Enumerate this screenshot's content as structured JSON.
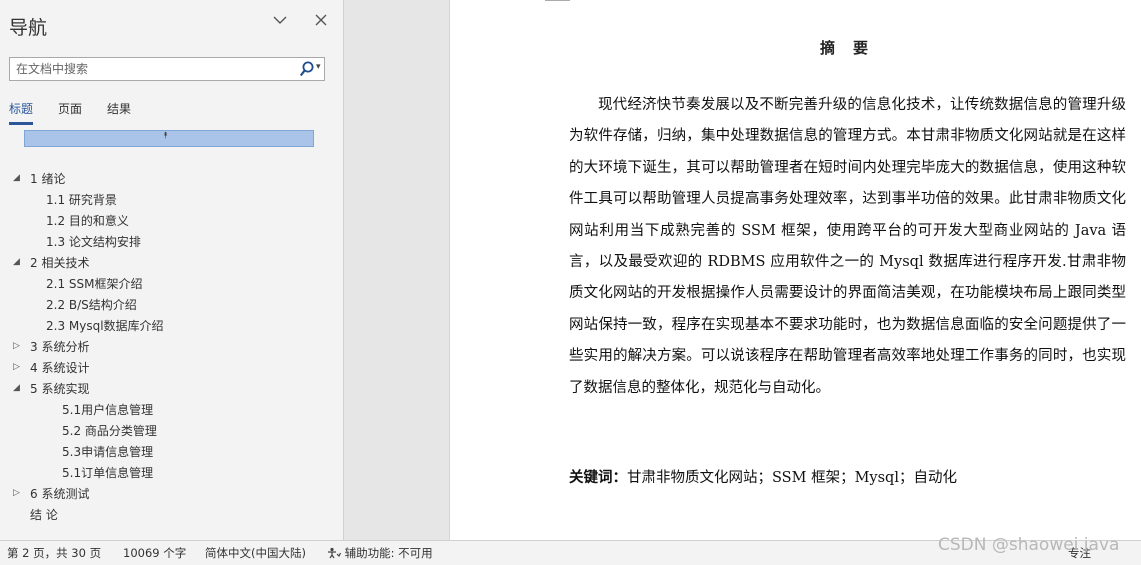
{
  "nav": {
    "title": "导航",
    "collapse_icon": "chevron-down-icon",
    "close_icon": "close-icon",
    "search": {
      "placeholder": "在文档中搜索",
      "value": ""
    },
    "tabs": [
      {
        "label": "标题",
        "active": true
      },
      {
        "label": "页面",
        "active": false
      },
      {
        "label": "结果",
        "active": false
      }
    ],
    "toc": [
      {
        "label": "1 绪论",
        "level": 1,
        "arrow": "expanded"
      },
      {
        "label": "1.1 研究背景",
        "level": 2
      },
      {
        "label": "1.2 目的和意义",
        "level": 2
      },
      {
        "label": "1.3 论文结构安排",
        "level": 2
      },
      {
        "label": "2 相关技术",
        "level": 1,
        "arrow": "expanded"
      },
      {
        "label": "2.1 SSM框架介绍",
        "level": 2
      },
      {
        "label": "2.2 B/S结构介绍",
        "level": 2
      },
      {
        "label": "2.3 Mysql数据库介绍",
        "level": 2
      },
      {
        "label": "3 系统分析",
        "level": 1,
        "arrow": "collapsed"
      },
      {
        "label": "4 系统设计",
        "level": 1,
        "arrow": "collapsed"
      },
      {
        "label": "5 系统实现",
        "level": 1,
        "arrow": "expanded"
      },
      {
        "label": "5.1用户信息管理",
        "level": 3
      },
      {
        "label": "5.2 商品分类管理",
        "level": 3
      },
      {
        "label": "5.3申请信息管理",
        "level": 3
      },
      {
        "label": "5.1订单信息管理",
        "level": 3
      },
      {
        "label": "6 系统测试",
        "level": 1,
        "arrow": "collapsed"
      },
      {
        "label": "结  论",
        "level": 1
      }
    ]
  },
  "document": {
    "abstract_title": "摘要",
    "abstract_body": "现代经济快节奏发展以及不断完善升级的信息化技术，让传统数据信息的管理升级为软件存储，归纳，集中处理数据信息的管理方式。本甘肃非物质文化网站就是在这样的大环境下诞生，其可以帮助管理者在短时间内处理完毕庞大的数据信息，使用这种软件工具可以帮助管理人员提高事务处理效率，达到事半功倍的效果。此甘肃非物质文化网站利用当下成熟完善的 SSM 框架，使用跨平台的可开发大型商业网站的 Java 语言，以及最受欢迎的 RDBMS 应用软件之一的 Mysql 数据库进行程序开发.甘肃非物质文化网站的开发根据操作人员需要设计的界面简洁美观，在功能模块布局上跟同类型网站保持一致，程序在实现基本不要求功能时，也为数据信息面临的安全问题提供了一些实用的解决方案。可以说该程序在帮助管理者高效率地处理工作事务的同时，也实现了数据信息的整体化，规范化与自动化。",
    "keywords_label": "关键词：",
    "keywords": "甘肃非物质文化网站；SSM 框架；Mysql；自动化"
  },
  "statusbar": {
    "page": "第 2 页，共 30 页",
    "words": "10069 个字",
    "language": "简体中文(中国大陆)",
    "accessibility": "辅助功能: 不可用",
    "focus": "专注"
  },
  "watermark": "CSDN @shaowei java"
}
